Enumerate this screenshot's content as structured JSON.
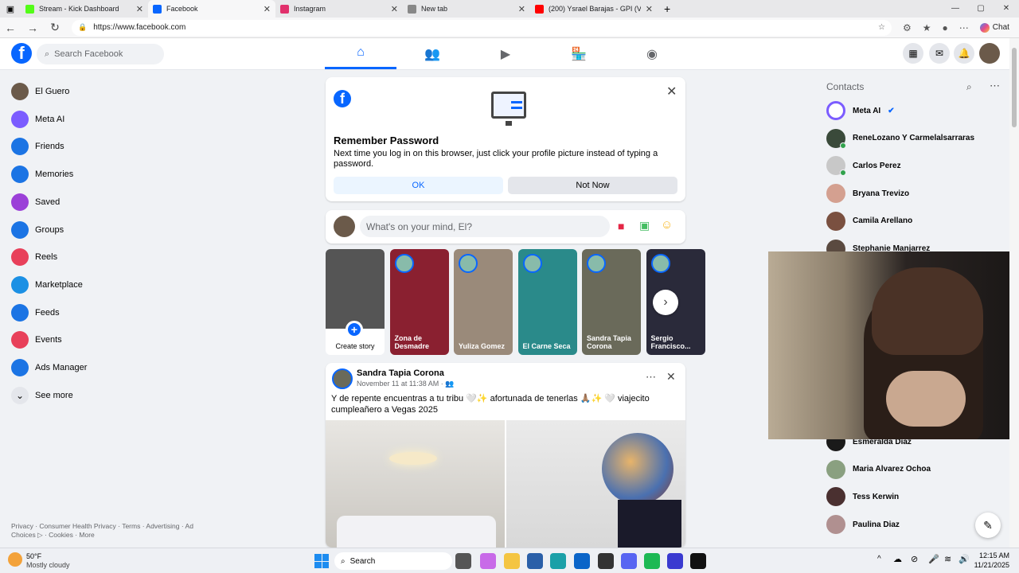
{
  "browser": {
    "tabs": [
      {
        "title": "Stream - Kick Dashboard",
        "color": "#53fc18"
      },
      {
        "title": "Facebook",
        "color": "#0866ff"
      },
      {
        "title": "Instagram",
        "color": "#e1306c"
      },
      {
        "title": "New tab",
        "color": "#888888"
      },
      {
        "title": "(200) Ysrael Barajas - GPI (Vi",
        "color": "#ff0000"
      }
    ],
    "url": "https://www.facebook.com",
    "chat_label": "Chat"
  },
  "fb": {
    "search_placeholder": "Search Facebook",
    "sidebar": [
      {
        "label": "El Guero",
        "icon": "avatar",
        "color": "#6b5a4a"
      },
      {
        "label": "Meta AI",
        "icon": "meta-ai-icon",
        "color": "#7b5cff"
      },
      {
        "label": "Friends",
        "icon": "friends-icon",
        "color": "#1b74e4"
      },
      {
        "label": "Memories",
        "icon": "memories-icon",
        "color": "#1b74e4"
      },
      {
        "label": "Saved",
        "icon": "saved-icon",
        "color": "#9b40d8"
      },
      {
        "label": "Groups",
        "icon": "groups-icon",
        "color": "#1b74e4"
      },
      {
        "label": "Reels",
        "icon": "reels-icon",
        "color": "#e8405a"
      },
      {
        "label": "Marketplace",
        "icon": "marketplace-icon",
        "color": "#1b90e4"
      },
      {
        "label": "Feeds",
        "icon": "feeds-icon",
        "color": "#1b74e4"
      },
      {
        "label": "Events",
        "icon": "events-icon",
        "color": "#e8405a"
      },
      {
        "label": "Ads Manager",
        "icon": "ads-manager-icon",
        "color": "#1b74e4"
      },
      {
        "label": "See more",
        "icon": "chevron-down-icon",
        "color": "#e4e6eb"
      }
    ],
    "footer": "Privacy · Consumer Health Privacy · Terms · Advertising · Ad Choices ▷ · Cookies · More",
    "remember": {
      "title": "Remember Password",
      "body": "Next time you log in on this browser, just click your profile picture instead of typing a password.",
      "ok": "OK",
      "not_now": "Not Now"
    },
    "composer_placeholder": "What's on your mind, El?",
    "stories": [
      {
        "label": "Create story",
        "color": "#555555"
      },
      {
        "label": "Zona de Desmadre",
        "color": "#8a2030"
      },
      {
        "label": "Yuliza Gomez",
        "color": "#9a8a7a"
      },
      {
        "label": "El Carne Seca",
        "color": "#2a8a8a"
      },
      {
        "label": "Sandra Tapia Corona",
        "color": "#6a6a5a"
      },
      {
        "label": "Sergio Francisco...",
        "color": "#2a2a3a"
      }
    ],
    "post": {
      "author": "Sandra Tapia Corona",
      "date": "November 11 at 11:38 AM ·",
      "text": "Y de repente encuentras a tu tribu 🤍✨ afortunada de tenerlas 🙏🏽✨ 🤍 viajecito cumpleañero a Vegas 2025"
    },
    "contacts_title": "Contacts",
    "contacts": [
      {
        "name": "Meta AI",
        "color": "#7b5cff",
        "online": false
      },
      {
        "name": "ReneLozano Y Carmelalsarraras",
        "color": "#3a4a3a",
        "online": true
      },
      {
        "name": "Carlos Perez",
        "color": "#c8c8c8",
        "online": true
      },
      {
        "name": "Bryana Trevizo",
        "color": "#d4a090",
        "online": false
      },
      {
        "name": "Camila Arellano",
        "color": "#7a5040",
        "online": false
      },
      {
        "name": "Stephanie Manjarrez",
        "color": "#5a4a40",
        "online": false
      },
      {
        "name": "Esmeralda Diaz",
        "color": "#1a1a1a",
        "online": false
      },
      {
        "name": "Maria Alvarez Ochoa",
        "color": "#8aa080",
        "online": false
      },
      {
        "name": "Tess Kerwin",
        "color": "#4a3030",
        "online": false
      },
      {
        "name": "Paulina Diaz",
        "color": "#b09090",
        "online": false
      }
    ]
  },
  "taskbar": {
    "temp": "50°F",
    "weather": "Mostly cloudy",
    "search": "Search",
    "time": "12:15 AM",
    "date": "11/21/2025"
  }
}
